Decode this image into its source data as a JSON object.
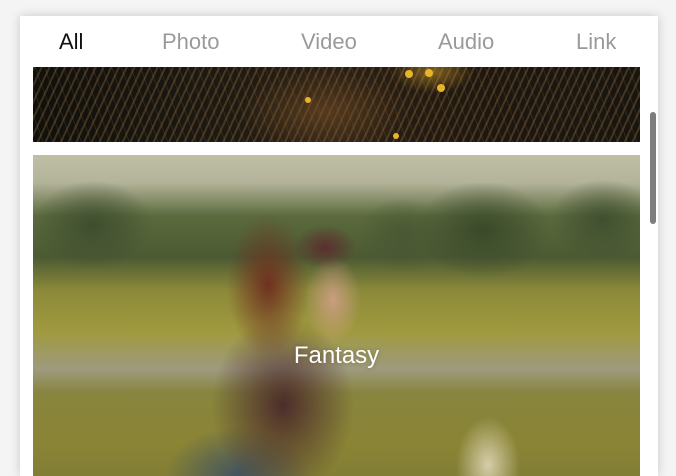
{
  "tabs": [
    {
      "label": "All",
      "active": true
    },
    {
      "label": "Photo",
      "active": false
    },
    {
      "label": "Video",
      "active": false
    },
    {
      "label": "Audio",
      "active": false
    },
    {
      "label": "Link",
      "active": false
    }
  ],
  "feed": {
    "items": [
      {
        "caption": ""
      },
      {
        "caption": "Fantasy"
      }
    ]
  },
  "colors": {
    "active_tab": "#111111",
    "inactive_tab": "#9a9a9a",
    "card_background": "#ffffff",
    "scrollbar": "#7d7d7d"
  }
}
